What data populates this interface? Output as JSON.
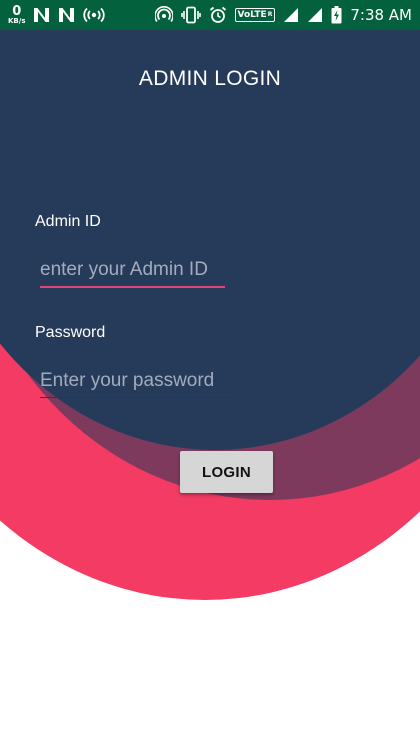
{
  "status_bar": {
    "net_speed_value": "0",
    "net_speed_unit": "KB/s",
    "volte_label": "VoLTE",
    "volte_sup": "R",
    "time": "7:38 AM",
    "background_color": "#03613d",
    "icons": [
      "n-notification-icon",
      "n-notification-icon",
      "hotspot-icon",
      "wifi-calling-icon",
      "vibrate-icon",
      "alarm-icon",
      "signal-icon",
      "battery-charging-icon"
    ]
  },
  "colors": {
    "navy": "#263a5a",
    "plum": "#7e3a5c",
    "pink": "#f33b63",
    "button_bg": "#d6d6d6"
  },
  "login": {
    "title": "ADMIN LOGIN",
    "admin_id_label": "Admin ID",
    "admin_id_placeholder": "enter your Admin ID",
    "admin_id_value": "",
    "password_label": "Password",
    "password_placeholder": "Enter your password",
    "password_value": "",
    "login_button_label": "LOGIN"
  }
}
